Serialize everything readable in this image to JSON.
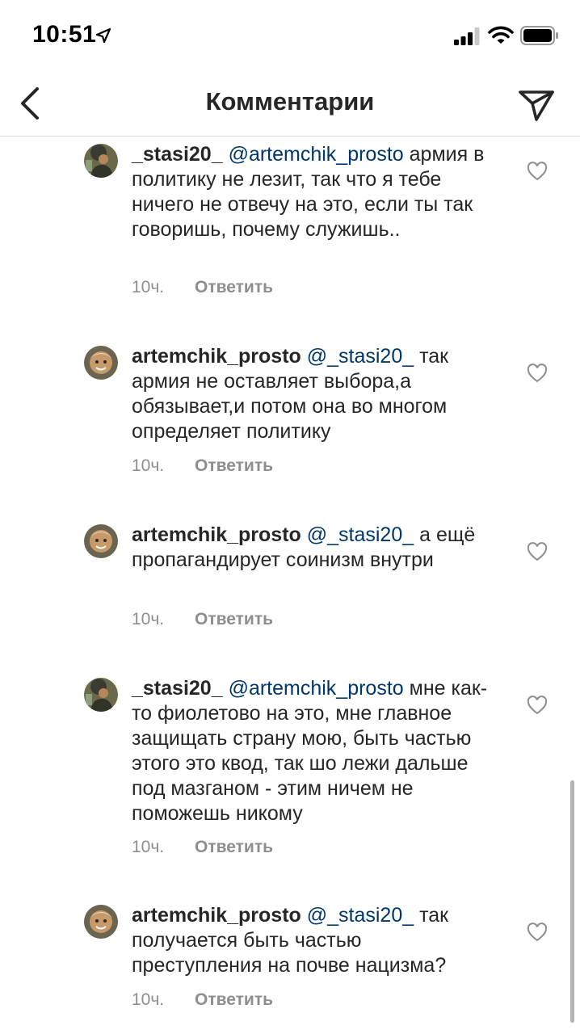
{
  "status_bar": {
    "time": "10:51"
  },
  "header": {
    "title": "Комментарии"
  },
  "comments": [
    {
      "username": "_stasi20_",
      "mention": "@artemchik_prosto",
      "text": "армия в политику не лезит, так что я тебе ничего не отвечу на это, если ты так говоришь, почему служишь..",
      "time": "10ч.",
      "reply_label": "Ответить"
    },
    {
      "username": "artemchik_prosto",
      "mention": "@_stasi20_",
      "text": "так армия не оставляет выбора,а обязывает,и потом она во многом определяет политику",
      "time": "10ч.",
      "reply_label": "Ответить"
    },
    {
      "username": "artemchik_prosto",
      "mention": "@_stasi20_",
      "text": "а ещё пропагандирует соинизм внутри",
      "time": "10ч.",
      "reply_label": "Ответить"
    },
    {
      "username": "_stasi20_",
      "mention": "@artemchik_prosto",
      "text": "мне как-то фиолетово на это, мне главное защищать страну мою, быть частью этого это квод, так шо лежи дальше под мазганом - этим ничем не поможешь никому",
      "time": "10ч.",
      "reply_label": "Ответить"
    },
    {
      "username": "artemchik_prosto",
      "mention": "@_stasi20_",
      "text": "так получается быть частью преступления на почве нацизма?",
      "time": "10ч.",
      "reply_label": "Ответить"
    }
  ],
  "icons": {
    "back": "chevron-left-icon",
    "send": "paper-plane-icon",
    "like": "heart-outline-icon"
  }
}
